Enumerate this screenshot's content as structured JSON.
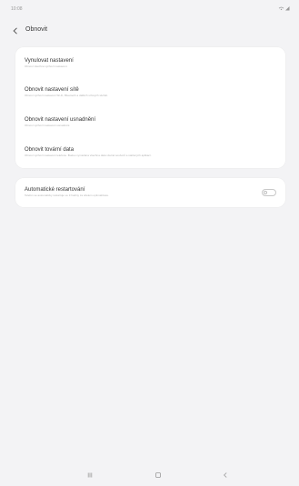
{
  "status_bar": {
    "time": "10:08",
    "icons": "wifi-icon signal-icon"
  },
  "app_bar": {
    "title": "Obnovit"
  },
  "reset_options": [
    {
      "title": "Vynulovat nastavení",
      "description": "Obnoví všechna výchozí nastavení."
    },
    {
      "title": "Obnovit nastavení sítě",
      "description": "Obnoví výchozí nastavení Wi-Fi, Bluetooth a dalších síťových služeb."
    },
    {
      "title": "Obnovit nastavení usnadnění",
      "description": "Obnoví výchozí nastavení usnadnění."
    },
    {
      "title": "Obnovit tovární data",
      "description": "Obnoví výchozí nastavení telefonu. Budou vymazána všechna data včetně souborů a stažených aplikací."
    }
  ],
  "auto_restart": {
    "title": "Automatické restartování",
    "description": "Telefon se automaticky restartuje ve 3 hodiny za účelem optimalizace."
  },
  "nav": {
    "icons": [
      "recents-icon",
      "home-icon",
      "back-icon"
    ]
  },
  "colors": {
    "background": "#f3f3f5",
    "card": "#ffffff"
  }
}
